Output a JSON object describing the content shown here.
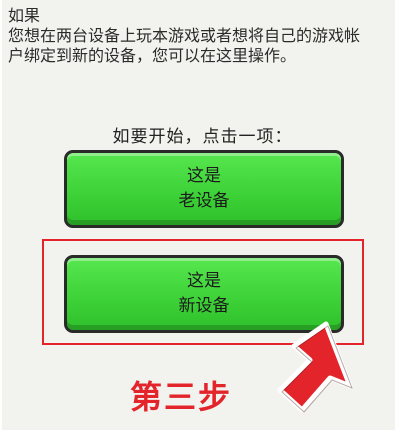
{
  "intro": {
    "line1": "如果",
    "line2": "您想在两台设备上玩本游戏或者想将自己的游戏帐",
    "line3": "户绑定到新的设备，您可以在这里操作。"
  },
  "prompt": "如要开始，点击一项：",
  "buttons": {
    "old": {
      "line1": "这是",
      "line2": "老设备"
    },
    "new": {
      "line1": "这是",
      "line2": "新设备"
    }
  },
  "step_label": "第三步",
  "icons": {
    "pointer": "pointing-arrow-icon"
  },
  "colors": {
    "button_green": "#3ed338",
    "highlight_red": "#e3242b"
  }
}
